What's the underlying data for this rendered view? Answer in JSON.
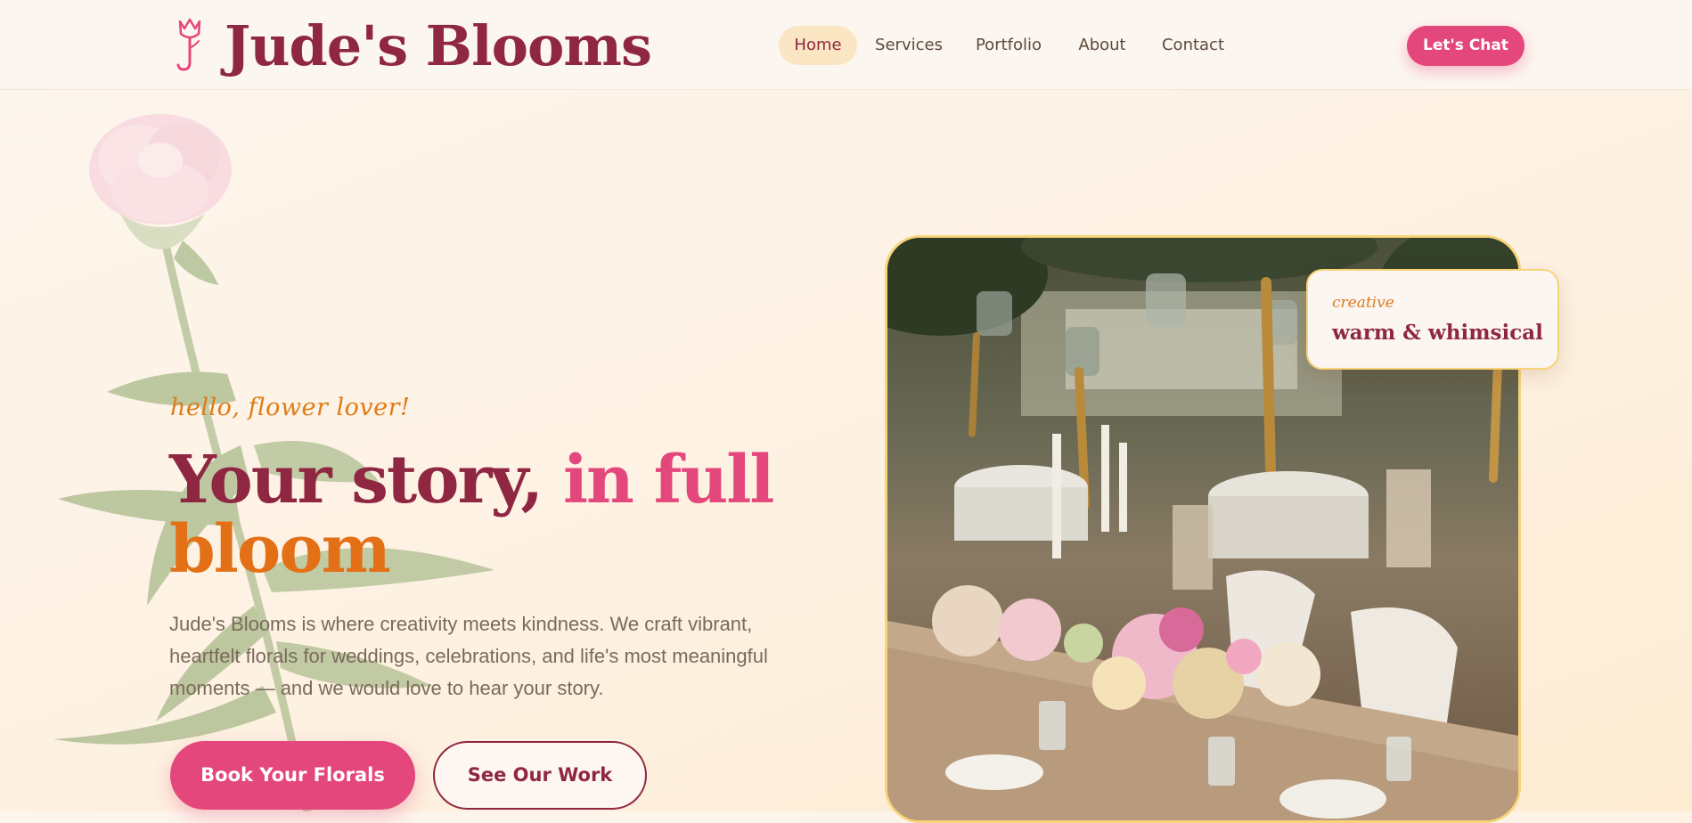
{
  "header": {
    "brand": "Jude's Blooms",
    "logo_icon": "tulip-j-icon",
    "nav": [
      {
        "label": "Home",
        "active": true
      },
      {
        "label": "Services",
        "active": false
      },
      {
        "label": "Portfolio",
        "active": false
      },
      {
        "label": "About",
        "active": false
      },
      {
        "label": "Contact",
        "active": false
      }
    ],
    "cta_label": "Let's Chat"
  },
  "hero": {
    "eyebrow": "hello, flower lover!",
    "headline_part1": "Your story, ",
    "headline_part2": "in full",
    "headline_part3": "bloom",
    "intro": "Jude's Blooms is where creativity meets kindness. We craft vibrant, heartfelt florals for weddings, celebrations, and life's most meaningful moments — and we would love to hear your story.",
    "primary_button": "Book Your Florals",
    "secondary_button": "See Our Work"
  },
  "badge": {
    "small": "creative",
    "big": "warm & whimsical"
  },
  "colors": {
    "brand": "#8f2742",
    "accent_pink": "#e4477b",
    "accent_orange": "#e37016",
    "gold_border": "#f7d37a",
    "active_nav_bg": "#fbe6c4"
  }
}
